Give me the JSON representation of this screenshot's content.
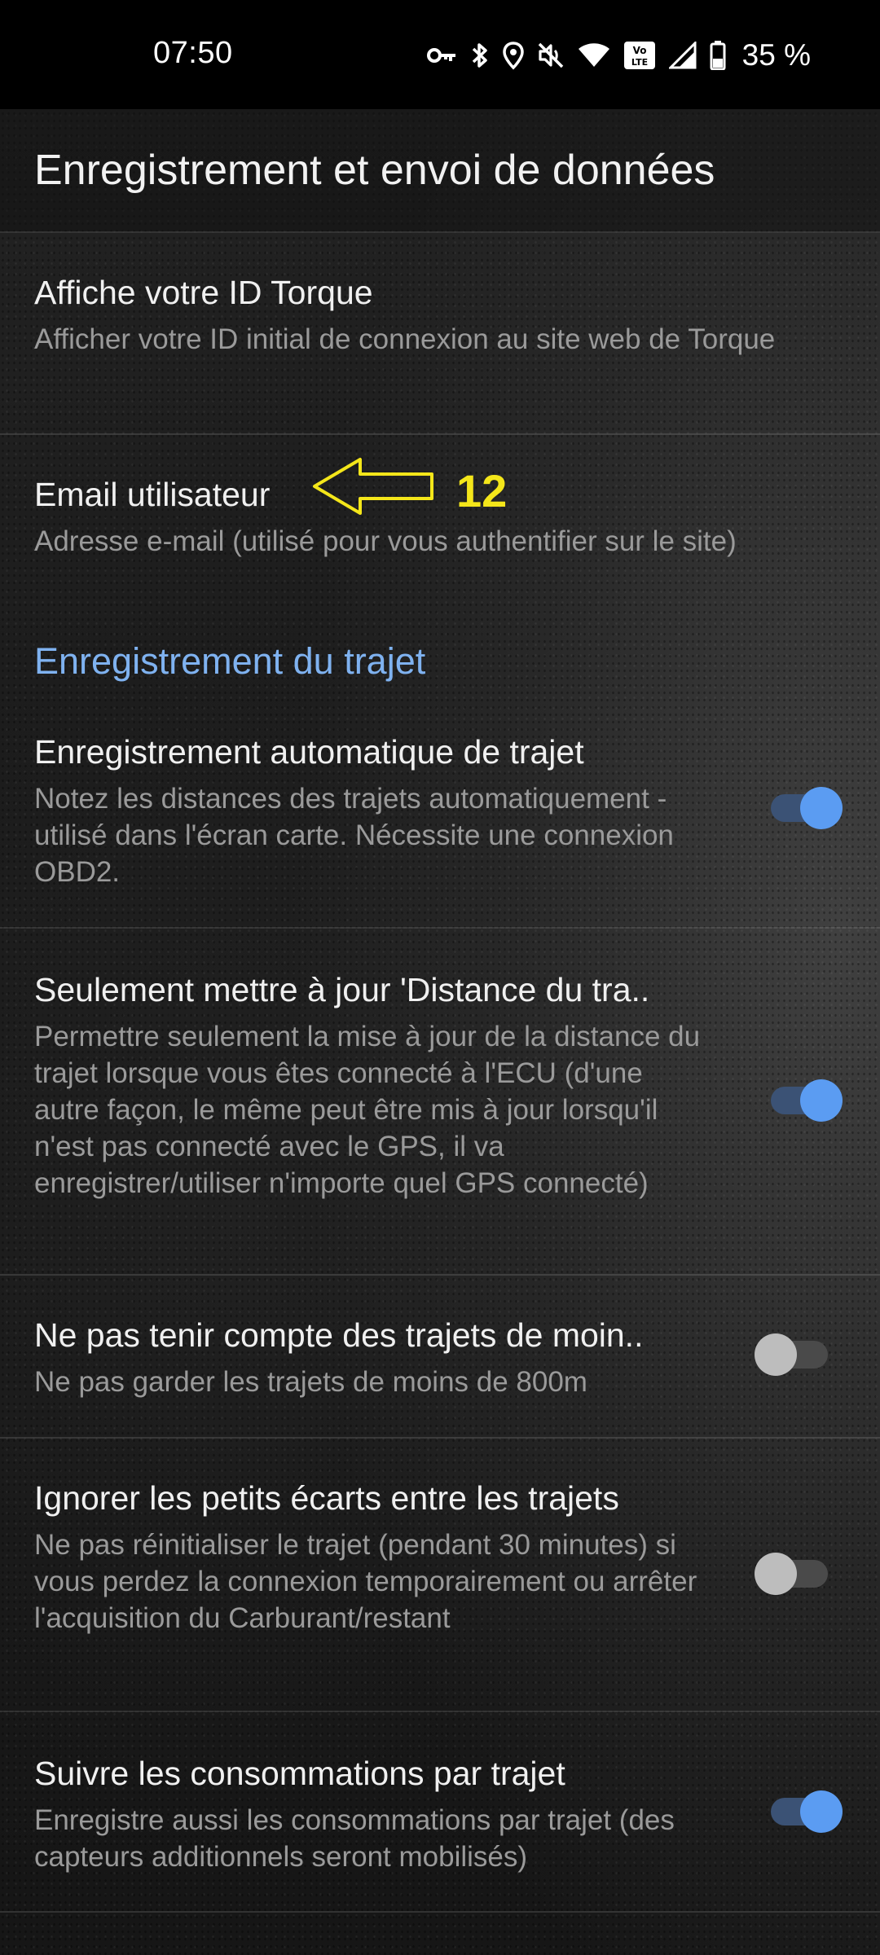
{
  "status_bar": {
    "time": "07:50",
    "battery_percent": "35 %",
    "icons": [
      "vpn-key-icon",
      "bluetooth-icon",
      "location-icon",
      "mute-icon",
      "wifi-icon",
      "volte-icon",
      "signal-icon",
      "battery-icon"
    ]
  },
  "header": {
    "title": "Enregistrement et envoi de données"
  },
  "prefs_top": [
    {
      "title": "Affiche votre ID Torque",
      "summary": "Afficher votre ID initial de connexion au site web de Torque"
    },
    {
      "title": "Email utilisateur",
      "summary": "Adresse e-mail (utilisé pour vous authentifier sur le site)"
    }
  ],
  "annotation": {
    "number": "12",
    "color": "#f4e61a"
  },
  "category": {
    "label": "Enregistrement du trajet",
    "color": "#7fb2f0"
  },
  "prefs_trip": [
    {
      "title": "Enregistrement automatique de trajet",
      "summary": "Notez les distances des trajets automatiquement - utilisé dans l'écran carte. Nécessite une connexion OBD2.",
      "enabled": true
    },
    {
      "title": "Seulement mettre à jour 'Distance du tra..",
      "summary": "Permettre seulement la mise à jour de la distance du trajet lorsque vous êtes connecté à l'ECU (d'une autre façon, le même peut être mis à jour lorsqu'il n'est pas connecté avec le GPS, il va enregistrer/utiliser n'importe quel GPS connecté)",
      "enabled": true
    },
    {
      "title": "Ne pas tenir compte des trajets de moin..",
      "summary": "Ne pas garder les trajets de moins de 800m",
      "enabled": false
    },
    {
      "title": "Ignorer les petits écarts entre les trajets",
      "summary": "Ne pas réinitialiser le trajet (pendant 30 minutes) si vous perdez la connexion temporairement ou arrêter l'acquisition du Carburant/restant",
      "enabled": false
    },
    {
      "title": "Suivre les consommations par trajet",
      "summary": "Enregistre aussi les consommations par trajet (des capteurs additionnels seront mobilisés)",
      "enabled": true
    }
  ],
  "colors": {
    "switch_on_thumb": "#5b9cf2",
    "switch_on_track": "#3b5275",
    "switch_off_thumb": "#bdbdbd",
    "switch_off_track": "#4a4a4a"
  }
}
